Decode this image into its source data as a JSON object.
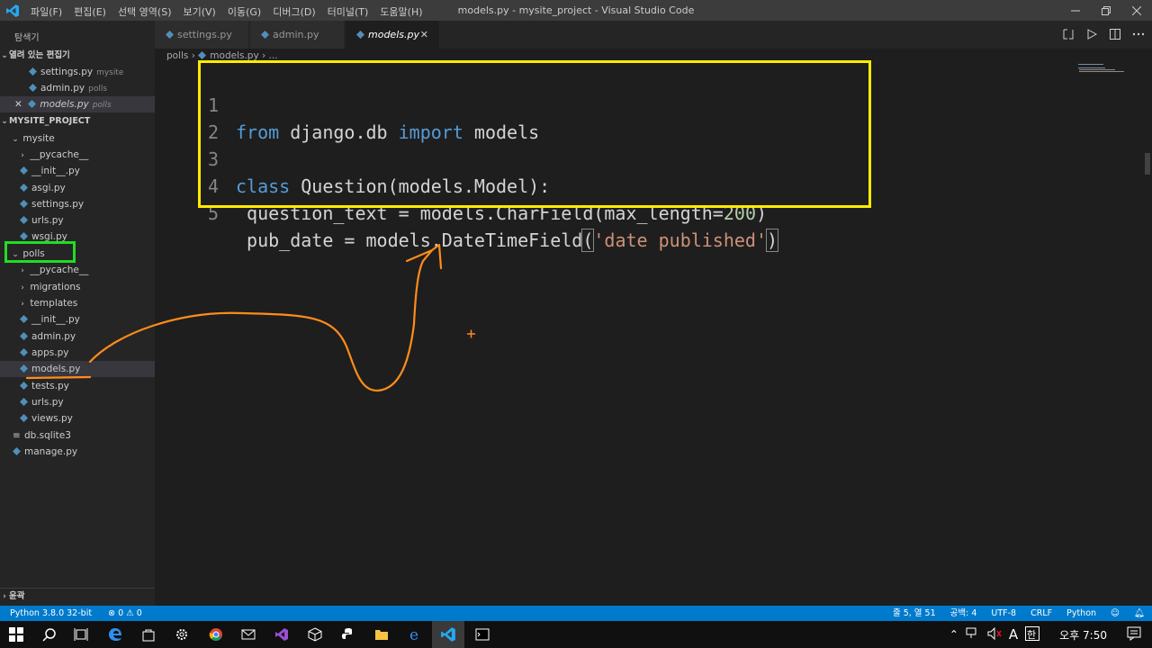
{
  "titlebar": {
    "menu": [
      "파일(F)",
      "편집(E)",
      "선택 영역(S)",
      "보기(V)",
      "이동(G)",
      "디버그(D)",
      "터미널(T)",
      "도움말(H)"
    ],
    "title": "models.py - mysite_project - Visual Studio Code"
  },
  "sidebar": {
    "header": "탐색기",
    "open_editors_label": "열려 있는 편집기",
    "open_editors": [
      {
        "name": "settings.py",
        "folder": "mysite"
      },
      {
        "name": "admin.py",
        "folder": "polls"
      },
      {
        "name": "models.py",
        "folder": "polls"
      }
    ],
    "project_label": "MYSITE_PROJECT",
    "tree": [
      {
        "name": "mysite"
      },
      {
        "name": "__pycache__"
      },
      {
        "name": "__init__.py"
      },
      {
        "name": "asgi.py"
      },
      {
        "name": "settings.py"
      },
      {
        "name": "urls.py"
      },
      {
        "name": "wsgi.py"
      },
      {
        "name": "polls"
      },
      {
        "name": "__pycache__"
      },
      {
        "name": "migrations"
      },
      {
        "name": "templates"
      },
      {
        "name": "__init__.py"
      },
      {
        "name": "admin.py"
      },
      {
        "name": "apps.py"
      },
      {
        "name": "models.py"
      },
      {
        "name": "tests.py"
      },
      {
        "name": "urls.py"
      },
      {
        "name": "views.py"
      },
      {
        "name": "db.sqlite3"
      },
      {
        "name": "manage.py"
      }
    ],
    "outline_label": "윤곽"
  },
  "tabs": [
    {
      "label": "settings.py"
    },
    {
      "label": "admin.py"
    },
    {
      "label": "models.py"
    }
  ],
  "breadcrumb": {
    "folder": "polls",
    "file": "models.py",
    "more": "..."
  },
  "code": {
    "line_numbers": [
      "1",
      "2",
      "3",
      "4",
      "5"
    ],
    "l1": {
      "kw1": "from",
      "mod": " django.db ",
      "kw2": "import",
      "name": " models"
    },
    "l3": {
      "kw": "class",
      "rest": " Question(models.Model):"
    },
    "l4": {
      "a": " question_text = models.CharField(max_length=",
      "num": "200",
      "b": ")"
    },
    "l5": {
      "a": " pub_date = models.DateTimeField",
      "open": "(",
      "str": "'date published'",
      "close": ")"
    }
  },
  "statusbar": {
    "python": "Python 3.8.0 32-bit",
    "problems": "⊗ 0 ⚠ 0",
    "position": "줄 5, 열 51",
    "spaces": "공백: 4",
    "encoding": "UTF-8",
    "eol": "CRLF",
    "language": "Python"
  },
  "taskbar": {
    "ime": "A",
    "time": "오후 7:50"
  },
  "colors": {
    "accent": "#007acc",
    "highlight_code": "#ffeb00",
    "highlight_folder": "#22dd22",
    "annotation": "#ff8c1a"
  }
}
